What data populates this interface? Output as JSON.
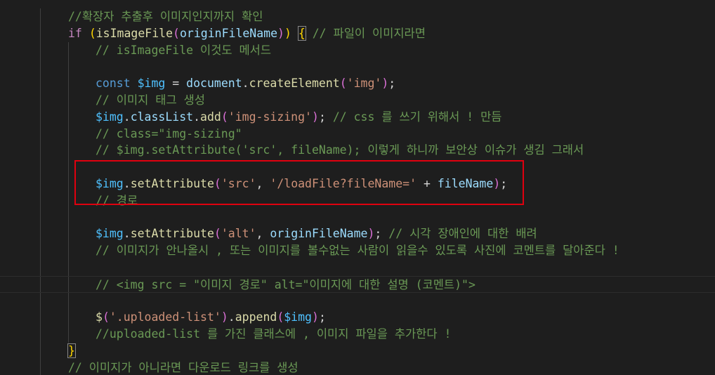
{
  "colors": {
    "background": "#1e1e1e",
    "comment": "#6a9955",
    "keyword_control": "#c586c0",
    "keyword": "#569cd6",
    "function": "#dcdcaa",
    "variable": "#9cdcfe",
    "constant": "#4fc1ff",
    "string": "#ce9178",
    "punctuation": "#d4d4d4",
    "bracket_yellow": "#ffd700",
    "bracket_purple": "#da70d6",
    "bracket_blue": "#179fff",
    "highlight_box": "#e0000f"
  },
  "editor": {
    "lines": [
      {
        "indent": 2,
        "tokens": [
          [
            "//확장자 추출후 이미지인지까지 확인",
            "comment"
          ]
        ]
      },
      {
        "indent": 2,
        "tokens": [
          [
            "if",
            "keyword_control"
          ],
          [
            " ",
            "punctuation"
          ],
          [
            "(",
            "bracket_yellow"
          ],
          [
            "isImageFile",
            "function"
          ],
          [
            "(",
            "bracket_purple"
          ],
          [
            "originFileName",
            "variable"
          ],
          [
            ")",
            "bracket_purple"
          ],
          [
            ")",
            "bracket_yellow"
          ],
          [
            " ",
            "punctuation"
          ],
          [
            "{",
            "bracket_yellow"
          ],
          [
            " ",
            "punctuation"
          ],
          [
            "// 파일이 이미지라면",
            "comment"
          ]
        ]
      },
      {
        "indent": 3,
        "tokens": [
          [
            "// isImageFile 이것도 메서드",
            "comment"
          ]
        ]
      },
      {
        "indent": 0,
        "tokens": []
      },
      {
        "indent": 3,
        "tokens": [
          [
            "const",
            "keyword"
          ],
          [
            " ",
            "punctuation"
          ],
          [
            "$img",
            "constant"
          ],
          [
            " = ",
            "punctuation"
          ],
          [
            "document",
            "variable"
          ],
          [
            ".",
            "punctuation"
          ],
          [
            "createElement",
            "function"
          ],
          [
            "(",
            "bracket_purple"
          ],
          [
            "'img'",
            "string"
          ],
          [
            ")",
            "bracket_purple"
          ],
          [
            ";",
            "punctuation"
          ]
        ]
      },
      {
        "indent": 3,
        "tokens": [
          [
            "// 이미지 태그 생성",
            "comment"
          ]
        ]
      },
      {
        "indent": 3,
        "tokens": [
          [
            "$img",
            "constant"
          ],
          [
            ".",
            "punctuation"
          ],
          [
            "classList",
            "variable"
          ],
          [
            ".",
            "punctuation"
          ],
          [
            "add",
            "function"
          ],
          [
            "(",
            "bracket_purple"
          ],
          [
            "'img-sizing'",
            "string"
          ],
          [
            ")",
            "bracket_purple"
          ],
          [
            ";",
            "punctuation"
          ],
          [
            " ",
            "punctuation"
          ],
          [
            "// css 를 쓰기 위해서 ! 만듬",
            "comment"
          ]
        ]
      },
      {
        "indent": 3,
        "tokens": [
          [
            "// class=\"img-sizing\"",
            "comment"
          ]
        ]
      },
      {
        "indent": 3,
        "tokens": [
          [
            "// $img.setAttribute('src', fileName); 이렇게 하니까 보안상 이슈가 생김 그래서",
            "comment"
          ]
        ]
      },
      {
        "indent": 0,
        "tokens": []
      },
      {
        "indent": 3,
        "tokens": [
          [
            "$img",
            "constant"
          ],
          [
            ".",
            "punctuation"
          ],
          [
            "setAttribute",
            "function"
          ],
          [
            "(",
            "bracket_purple"
          ],
          [
            "'src'",
            "string"
          ],
          [
            ", ",
            "punctuation"
          ],
          [
            "'/loadFile?fileName='",
            "string"
          ],
          [
            " + ",
            "punctuation"
          ],
          [
            "fileName",
            "variable"
          ],
          [
            ")",
            "bracket_purple"
          ],
          [
            ";",
            "punctuation"
          ]
        ]
      },
      {
        "indent": 3,
        "tokens": [
          [
            "// 경로",
            "comment"
          ]
        ]
      },
      {
        "indent": 0,
        "tokens": []
      },
      {
        "indent": 3,
        "tokens": [
          [
            "$img",
            "constant"
          ],
          [
            ".",
            "punctuation"
          ],
          [
            "setAttribute",
            "function"
          ],
          [
            "(",
            "bracket_purple"
          ],
          [
            "'alt'",
            "string"
          ],
          [
            ", ",
            "punctuation"
          ],
          [
            "originFileName",
            "variable"
          ],
          [
            ")",
            "bracket_purple"
          ],
          [
            ";",
            "punctuation"
          ],
          [
            " ",
            "punctuation"
          ],
          [
            "// 시각 장애인에 대한 배려",
            "comment"
          ]
        ]
      },
      {
        "indent": 3,
        "tokens": [
          [
            "// 이미지가 안나올시 , 또는 이미지를 볼수없는 사람이 읽을수 있도록 사진에 코멘트를 달아준다 !",
            "comment"
          ]
        ]
      },
      {
        "indent": 0,
        "tokens": []
      },
      {
        "indent": 3,
        "tokens": [
          [
            "// <img src = \"이미지 경로\" alt=\"이미지에 대한 설명 (코멘트)\">",
            "comment"
          ]
        ]
      },
      {
        "indent": 0,
        "tokens": []
      },
      {
        "indent": 3,
        "tokens": [
          [
            "$",
            "function"
          ],
          [
            "(",
            "bracket_purple"
          ],
          [
            "'.uploaded-list'",
            "string"
          ],
          [
            ")",
            "bracket_purple"
          ],
          [
            ".",
            "punctuation"
          ],
          [
            "append",
            "function"
          ],
          [
            "(",
            "bracket_purple"
          ],
          [
            "$img",
            "constant"
          ],
          [
            ")",
            "bracket_purple"
          ],
          [
            ";",
            "punctuation"
          ]
        ]
      },
      {
        "indent": 3,
        "tokens": [
          [
            "//uploaded-list 를 가진 클래스에 , 이미지 파일을 추가한다 !",
            "comment"
          ]
        ]
      },
      {
        "indent": 2,
        "tokens": [
          [
            "}",
            "bracket_yellow"
          ]
        ]
      },
      {
        "indent": 2,
        "tokens": [
          [
            "// 이미지가 아니라면 다운로드 링크를 생성",
            "comment"
          ]
        ]
      }
    ]
  }
}
